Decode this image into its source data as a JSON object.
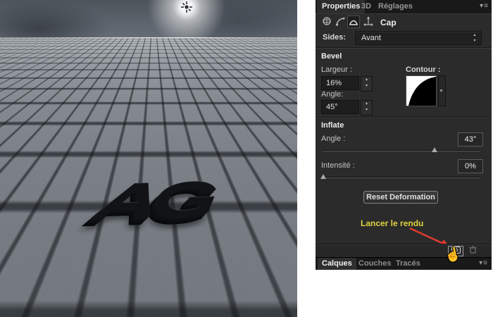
{
  "viewport": {
    "object_label": "AG",
    "colors": {
      "ground_red_line": "#d40f0f",
      "guide_blue": "#2323c8",
      "axis_green": "#3fae3f",
      "axis_red": "#c03b33"
    }
  },
  "properties_panel": {
    "tabs": [
      {
        "label": "Properties",
        "active": true
      },
      {
        "label": "3D",
        "active": false
      },
      {
        "label": "Réglages",
        "active": false
      }
    ],
    "mesh_header": {
      "title": "Cap"
    },
    "sides": {
      "label": "Sides:",
      "value": "Avant"
    },
    "bevel": {
      "title": "Bevel",
      "largeur_label": "Largeur :",
      "largeur_value": "16%",
      "angle_label": "Angle:",
      "angle_value": "45°",
      "contour_label": "Contour :"
    },
    "inflate": {
      "title": "Inflate",
      "angle_label": "Angle :",
      "angle_value": "43°",
      "angle_slider_percent": 71,
      "intensite_label": "Intensité :",
      "intensite_value": "0%",
      "intensite_slider_percent": 0.5
    },
    "reset_button_label": "Reset Deformation",
    "annotation": {
      "text": "Lancer le rendu",
      "color": "#ddd23f",
      "arrow_color": "#e03a2f"
    }
  },
  "layers_panel": {
    "tabs": [
      {
        "label": "Calques",
        "active": true
      },
      {
        "label": "Couches",
        "active": false
      },
      {
        "label": "Tracés",
        "active": false
      }
    ]
  },
  "icons": {
    "panel_menu_glyph": "▾≡",
    "stepper_up": "▴",
    "stepper_down": "▾",
    "hand_cursor": "☝"
  }
}
